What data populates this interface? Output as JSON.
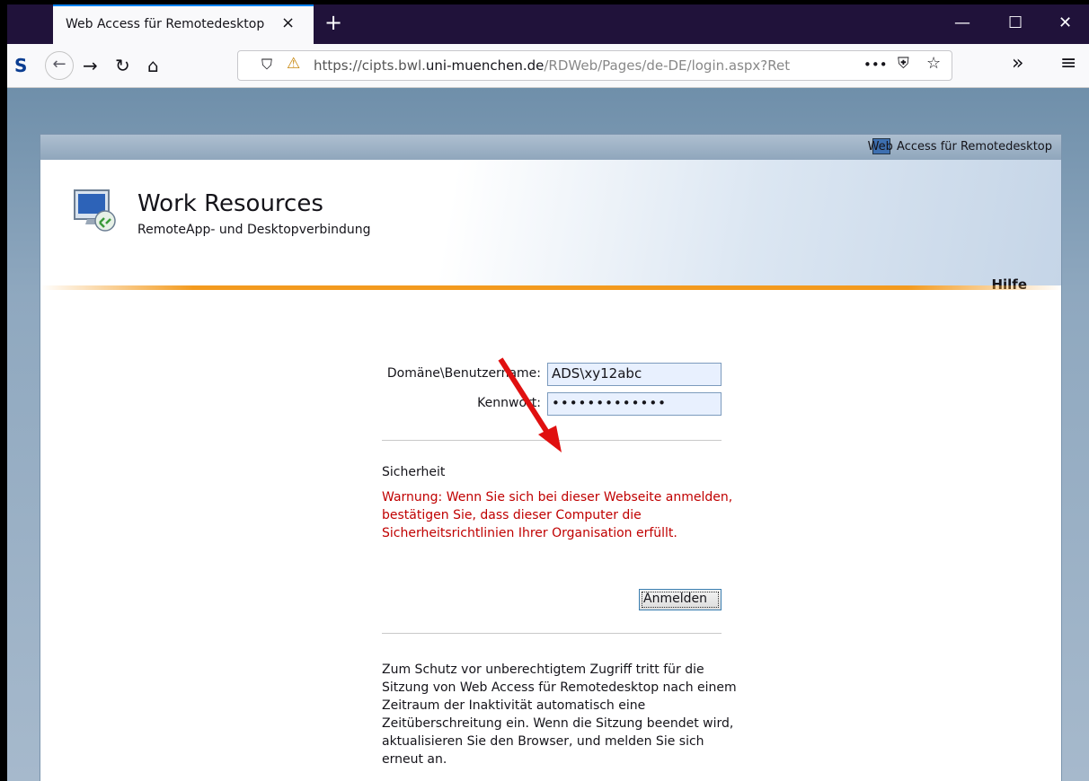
{
  "browser": {
    "tab_title": "Web Access für Remotedesktop",
    "tab_close": "×",
    "new_tab": "+",
    "url_host_prefix": "https://cipts.bwl.",
    "url_host_main": "uni-muenchen.de",
    "url_path": "/RDWeb/Pages/de-DE/login.aspx?Ret",
    "page_actions": "•••",
    "overflow": "»",
    "menu": "≡",
    "win_min": "—",
    "win_max": "☐",
    "win_close": "✕",
    "icons": [
      "s-icon",
      "back-icon",
      "forward-icon",
      "reload-icon",
      "home-icon",
      "shield-icon",
      "lock-warning-icon",
      "pocket-icon",
      "star-icon"
    ]
  },
  "page": {
    "topbar_label": "Web Access für Remotedesktop",
    "app_title": "Work Resources",
    "app_subtitle": "RemoteApp- und Desktopverbindung",
    "help_link": "Hilfe",
    "form": {
      "username_label": "Domäne\\Benutzername:",
      "username_value": "ADS\\xy12abc",
      "password_label": "Kennwort:",
      "password_value": "•••••••••••••"
    },
    "security_heading": "Sicherheit",
    "security_warning": "Warnung: Wenn Sie sich bei dieser Webseite anmelden, bestätigen Sie, dass dieser Computer die Sicherheitsrichtlinien Ihrer Organisation erfüllt.",
    "login_button": "Anmelden",
    "info_text": "Zum Schutz vor unberechtigtem Zugriff tritt für die Sitzung von Web Access für Remotedesktop nach einem Zeitraum der Inaktivität automatisch eine Zeitüberschreitung ein. Wenn die Sitzung beendet wird, aktualisieren Sie den Browser, und melden Sie sich erneut an."
  },
  "colors": {
    "warning": "#c00000",
    "accent_orange": "#f39a1e",
    "arrow": "#e01010"
  }
}
